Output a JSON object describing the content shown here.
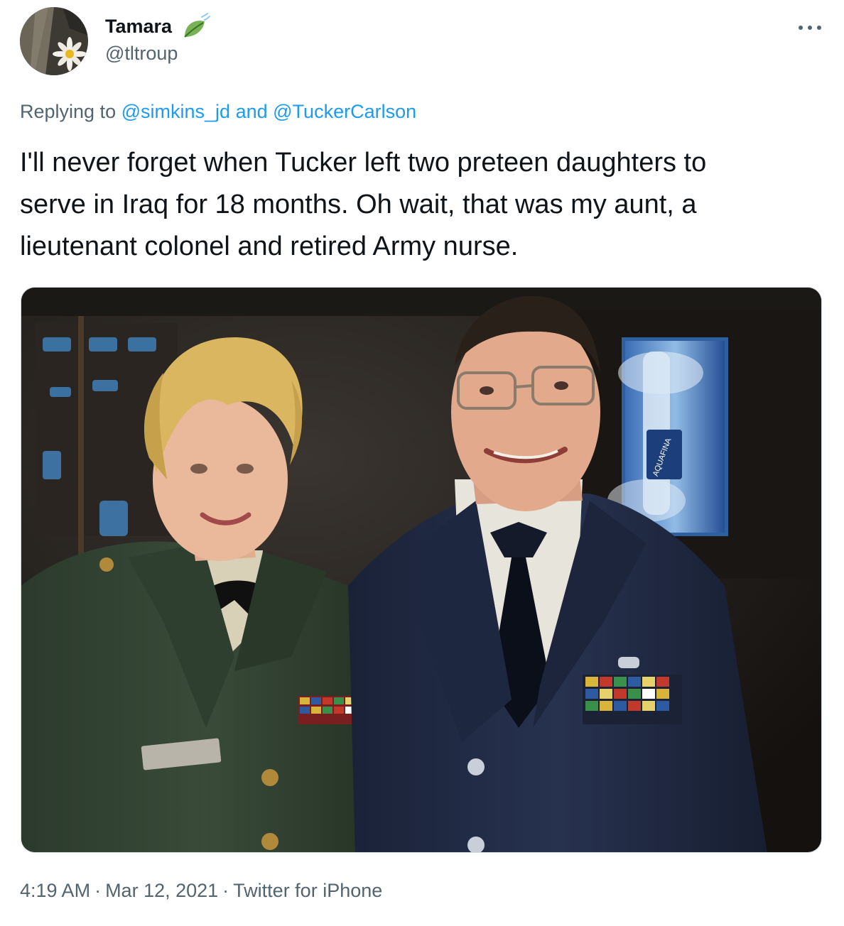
{
  "author": {
    "display_name": "Tamara",
    "handle": "@tltroup",
    "avatar_icon": "daisy-avatar",
    "badge_icon": "leaf-emoji-icon"
  },
  "menu_icon": "more-horizontal-icon",
  "reply": {
    "prefix": "Replying to",
    "mention_1": "@simkins_jd",
    "conjunction": "and",
    "mention_2": "@TuckerCarlson"
  },
  "text": {
    "line_1": "I'll never forget when Tucker left two preteen daughters to",
    "line_2": "serve in Iraq for 18 months. Oh wait, that was my aunt, a",
    "line_3": "lieutenant colonel and retired Army nurse."
  },
  "media": {
    "type": "photo",
    "bottle_label": "AQUAFINA"
  },
  "meta": {
    "time": "4:19 AM",
    "separator": "·",
    "date": "Mar 12, 2021",
    "source": "Twitter for iPhone"
  },
  "colors": {
    "text": "#0f1419",
    "secondary": "#536471",
    "link": "#1d9bf0",
    "border": "#cfd9de"
  }
}
